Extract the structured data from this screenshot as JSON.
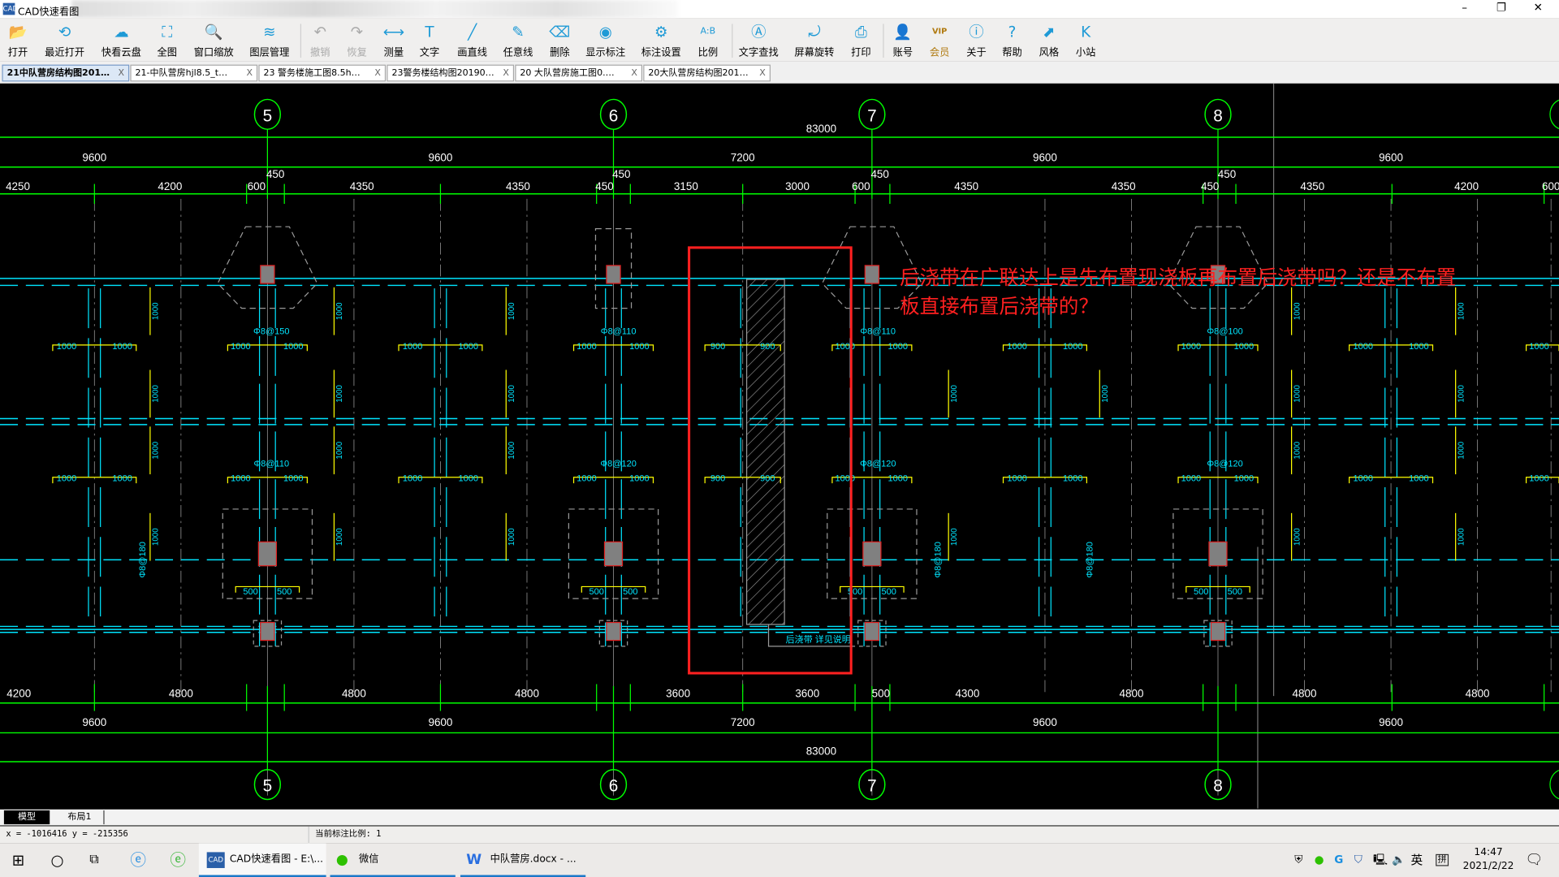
{
  "window": {
    "title": "CAD快速看图",
    "minimize": "–",
    "maximize": "❐",
    "close": "✕"
  },
  "toolbar": [
    {
      "label": "打开",
      "icon": "folder-open-icon",
      "glyph": "📂"
    },
    {
      "label": "最近打开",
      "icon": "recent-clock-icon",
      "glyph": "⟲"
    },
    {
      "label": "快看云盘",
      "icon": "cloud-icon",
      "glyph": "☁"
    },
    {
      "label": "全图",
      "icon": "fit-all-icon",
      "glyph": "⛶"
    },
    {
      "label": "窗口缩放",
      "icon": "window-zoom-icon",
      "glyph": "🔍"
    },
    {
      "label": "图层管理",
      "icon": "layers-icon",
      "glyph": "≋"
    },
    {
      "label": "撤销",
      "icon": "undo-icon",
      "glyph": "↶",
      "disabled": true
    },
    {
      "label": "恢复",
      "icon": "redo-icon",
      "glyph": "↷",
      "disabled": true
    },
    {
      "label": "测量",
      "icon": "ruler-icon",
      "glyph": "⟷"
    },
    {
      "label": "文字",
      "icon": "text-t-icon",
      "glyph": "T"
    },
    {
      "label": "画直线",
      "icon": "line-icon",
      "glyph": "╱"
    },
    {
      "label": "任意线",
      "icon": "freehand-pen-icon",
      "glyph": "✎"
    },
    {
      "label": "删除",
      "icon": "eraser-icon",
      "glyph": "⌫"
    },
    {
      "label": "显示标注",
      "icon": "eye-icon",
      "glyph": "◉"
    },
    {
      "label": "标注设置",
      "icon": "annotation-settings-icon",
      "glyph": "⚙"
    },
    {
      "label": "比例",
      "icon": "scale-ab-icon",
      "glyph": "A:B"
    },
    {
      "label": "文字查找",
      "icon": "text-search-icon",
      "glyph": "Ⓐ"
    },
    {
      "label": "屏幕旋转",
      "icon": "screen-rotate-icon",
      "glyph": "⤾"
    },
    {
      "label": "打印",
      "icon": "printer-icon",
      "glyph": "⎙"
    },
    {
      "label": "账号",
      "icon": "user-icon",
      "glyph": "👤"
    },
    {
      "label": "会员",
      "icon": "vip-icon",
      "glyph": "VIP",
      "vip": true
    },
    {
      "label": "关于",
      "icon": "info-icon",
      "glyph": "ⓘ"
    },
    {
      "label": "帮助",
      "icon": "help-icon",
      "glyph": "?"
    },
    {
      "label": "风格",
      "icon": "style-icon",
      "glyph": "⬈"
    },
    {
      "label": "小站",
      "icon": "site-k-icon",
      "glyph": "K"
    }
  ],
  "tabs": [
    {
      "label": "21中队营房结构图201…",
      "active": true
    },
    {
      "label": "21-中队营房hjl8.5_t…"
    },
    {
      "label": "23 警务楼施工图8.5h…"
    },
    {
      "label": "23警务楼结构图20190…"
    },
    {
      "label": "20 大队营房施工图0.…"
    },
    {
      "label": "20大队营房结构图201…"
    }
  ],
  "tab_close": "X",
  "drawing": {
    "axis_labels": [
      "5",
      "6",
      "7",
      "8",
      "5",
      "6",
      "7",
      "8"
    ],
    "top_dims": [
      "83000",
      "9600",
      "9600",
      "7200",
      "9600",
      "9600",
      "4250",
      "4200",
      "600",
      "450",
      "4350",
      "4350",
      "450",
      "450",
      "3150",
      "3000",
      "600",
      "450",
      "4350",
      "4350",
      "450",
      "450",
      "4350",
      "4200",
      "600"
    ],
    "bottom_dims": [
      "4200",
      "4800",
      "4800",
      "4800",
      "3600",
      "3600",
      "500",
      "4300",
      "4800",
      "4800",
      "4800",
      "9600",
      "9600",
      "7200",
      "9600",
      "9600",
      "83000"
    ],
    "rebar_labels": [
      "Φ8@150",
      "Φ8@110",
      "Φ8@110",
      "Φ8@100",
      "Φ8@110",
      "Φ8@120",
      "Φ8@120",
      "Φ8@120",
      "Φ8@180",
      "Φ8@180",
      "Φ8@180"
    ],
    "bar_lengths": [
      "1000",
      "900",
      "500"
    ],
    "post_pour_note": "后浇带 详见说明",
    "question_line1": "后浇带在广联达上是先布置现浇板再布置后浇带吗？还是不布置",
    "question_line2": "板直接布置后浇带的？",
    "colors": {
      "background": "#000000",
      "axis": "#00ff00",
      "beam": "#00e5ff",
      "dim_text": "#ffffff",
      "rebar": "#ffff00",
      "column": "#808080",
      "annotation": "#ff2020"
    }
  },
  "layout_tabs": [
    {
      "label": "模型",
      "active": true
    },
    {
      "label": "布局1"
    }
  ],
  "status": {
    "coords": "x = -1016416 y = -215356",
    "scale": "当前标注比例: 1"
  },
  "taskbar": {
    "apps": [
      {
        "label": "CAD快速看图 - E:\\...",
        "active": true
      },
      {
        "label": "微信"
      },
      {
        "label": "中队营房.docx - ..."
      }
    ],
    "ime_lang": "英",
    "ime_mode": "拼",
    "time": "14:47",
    "date": "2021/2/22"
  }
}
